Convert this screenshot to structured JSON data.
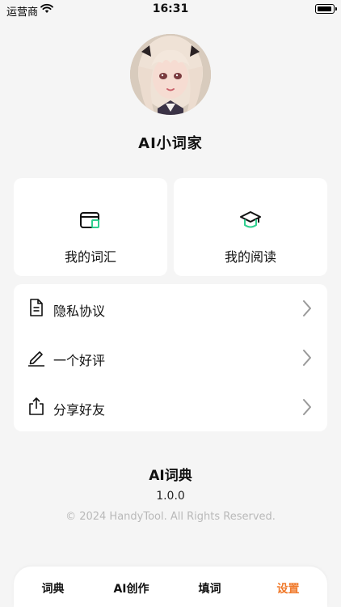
{
  "status_bar": {
    "carrier": "运营商",
    "time": "16:31",
    "wifi_icon": "wifi-icon",
    "battery_icon": "battery-icon"
  },
  "profile": {
    "avatar": "anime-girl-avatar",
    "name": "AI小词家"
  },
  "cards": [
    {
      "label": "我的词汇",
      "icon": "wordbook-icon"
    },
    {
      "label": "我的阅读",
      "icon": "graduation-cap-icon"
    }
  ],
  "menu": [
    {
      "label": "隐私协议",
      "icon": "document-icon"
    },
    {
      "label": "一个好评",
      "icon": "pencil-icon"
    },
    {
      "label": "分享好友",
      "icon": "share-icon"
    }
  ],
  "about": {
    "title": "AI词典",
    "version": "1.0.0",
    "copyright": "© 2024 HandyTool. All Rights Reserved."
  },
  "tabs": [
    {
      "label": "词典"
    },
    {
      "label": "AI创作"
    },
    {
      "label": "填词"
    },
    {
      "label": "设置",
      "active": true
    }
  ],
  "colors": {
    "accent_green": "#2fcf8f",
    "active_tab": "#f07a2c",
    "background": "#f5f5f5"
  }
}
